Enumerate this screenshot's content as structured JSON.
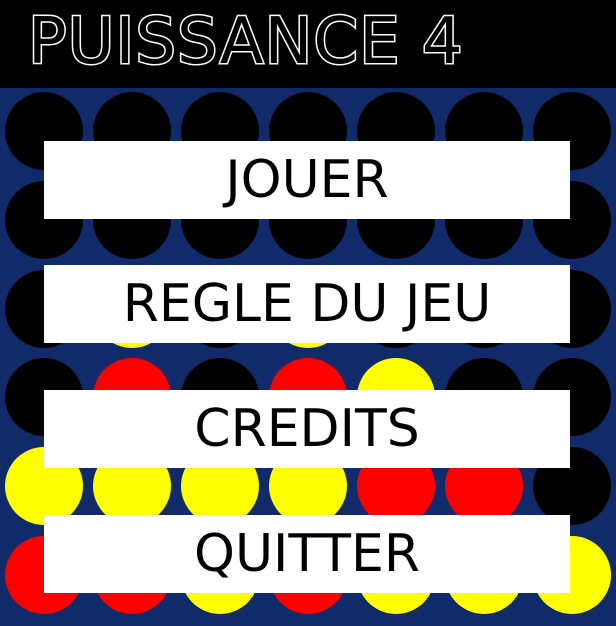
{
  "title": "PUISSANCE 4",
  "colors": {
    "board": "#112a6a",
    "empty": "#000000",
    "red": "#ff0000",
    "yellow": "#ffff00",
    "button_bg": "#ffffff",
    "button_text": "#000000"
  },
  "menu": {
    "play_label": "JOUER",
    "rules_label": "REGLE DU JEU",
    "credits_label": "CREDITS",
    "quit_label": "QUITTER"
  },
  "board": {
    "columns": 7,
    "rows_visible": 6,
    "cells": [
      [
        "empty",
        "empty",
        "empty",
        "empty",
        "empty",
        "empty",
        "empty"
      ],
      [
        "empty",
        "empty",
        "empty",
        "empty",
        "empty",
        "empty",
        "empty"
      ],
      [
        "empty",
        "yellow",
        "empty",
        "yellow",
        "empty",
        "empty",
        "empty"
      ],
      [
        "empty",
        "red",
        "empty",
        "red",
        "yellow",
        "empty",
        "empty"
      ],
      [
        "yellow",
        "yellow",
        "yellow",
        "yellow",
        "red",
        "red",
        "empty"
      ],
      [
        "red",
        "red",
        "yellow",
        "red",
        "yellow",
        "yellow",
        "yellow"
      ]
    ]
  }
}
